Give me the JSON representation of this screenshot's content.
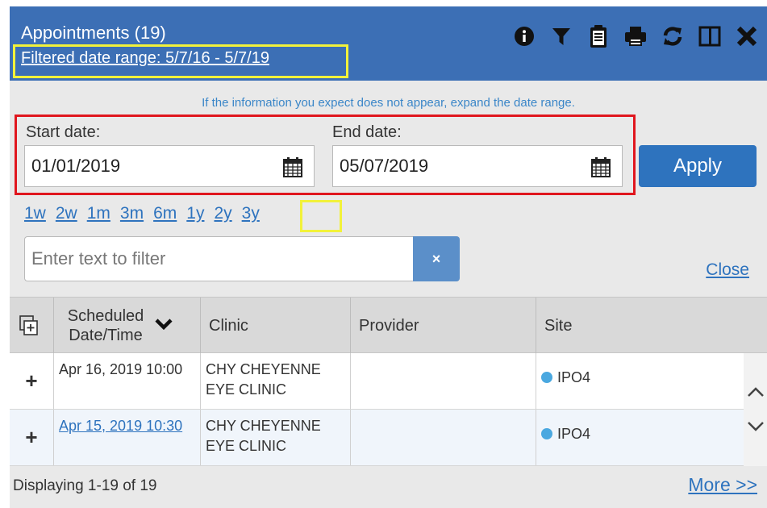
{
  "header": {
    "title": "Appointments (19)",
    "filtered_range": "Filtered date range: 5/7/16 - 5/7/19",
    "toolbar": [
      {
        "icon": "info-icon"
      },
      {
        "icon": "filter-icon"
      },
      {
        "icon": "clipboard-icon"
      },
      {
        "icon": "print-icon"
      },
      {
        "icon": "refresh-icon"
      },
      {
        "icon": "columns-icon"
      },
      {
        "icon": "close-icon"
      }
    ]
  },
  "info_message": "If the information you expect does not appear, expand the date range.",
  "date_range": {
    "start_label": "Start date:",
    "start_value": "01/01/2019",
    "end_label": "End date:",
    "end_value": "05/07/2019",
    "apply_label": "Apply"
  },
  "quick_ranges": [
    "1w",
    "2w",
    "1m",
    "3m",
    "6m",
    "1y",
    "2y",
    "3y"
  ],
  "filter": {
    "placeholder": "Enter text to filter",
    "clear_label": "×",
    "close_label": "Close"
  },
  "table": {
    "columns": [
      "Scheduled Date/Time",
      "Clinic",
      "Provider",
      "Site"
    ],
    "rows": [
      {
        "expand": "+",
        "datetime": "Apr 16, 2019 10:00",
        "clinic": "CHY CHEYENNE EYE CLINIC",
        "provider": "",
        "site": "IPO4"
      },
      {
        "expand": "+",
        "datetime": "Apr 15, 2019 10:30",
        "clinic": "CHY CHEYENNE EYE CLINIC",
        "provider": "",
        "site": "IPO4"
      }
    ]
  },
  "footer": {
    "display_count": "Displaying 1-19 of 19",
    "more_label": "More >>"
  },
  "colors": {
    "header_bg": "#3c6fb5",
    "accent": "#2e73be",
    "highlight_yellow": "#f2f23a",
    "highlight_red": "#e0161e",
    "site_dot": "#4aa8e0"
  }
}
